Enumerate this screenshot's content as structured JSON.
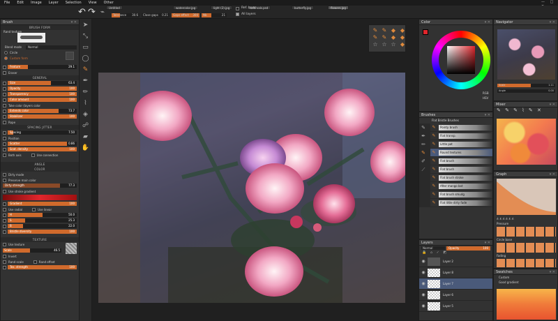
{
  "menu": [
    "File",
    "Edit",
    "Image",
    "Layer",
    "Selection",
    "View",
    "Other"
  ],
  "toolbar": {
    "tabs": [
      "Untitled",
      "watercolor.jpg",
      "light (2).jpg",
      "colorvals.psd",
      "butterfly.jpg",
      "flowers.jpg"
    ],
    "tolerance_label": "Tolerance",
    "tolerance_val": "30.6",
    "close_gaps_label": "Close gaps",
    "close_gaps_val": "0.21",
    "gaps_effect_label": "Gaps effect",
    "gaps_effect_val": "300",
    "nb_label": "Nb",
    "nb_val": "21",
    "ref_layer": "Ref. layer",
    "all_layers": "All layers"
  },
  "brush_panel": {
    "title": "Brush",
    "brush_form": "BRUSH FORM",
    "rand_texture": "Rand texture",
    "blend_mode_label": "Blend mode",
    "blend_mode_value": "Normal",
    "circle": "Circle",
    "custom_form": "Custom form",
    "feature_label": "Feature",
    "feature_val": "29.1",
    "feature_pct": 0.29,
    "eraser": "Eraser",
    "general": "GENERAL",
    "general_sliders": [
      {
        "label": "Size",
        "val": "63.4",
        "pct": 0.63
      },
      {
        "label": "Opacity",
        "val": "100",
        "pct": 1.0
      },
      {
        "label": "Transparency",
        "val": "100",
        "pct": 1.0
      },
      {
        "label": "Color amount",
        "val": "100",
        "pct": 1.0
      }
    ],
    "take_color": "Take color (layers color",
    "general_sliders2": [
      {
        "label": "Extends color",
        "val": "73.7",
        "pct": 0.74
      },
      {
        "label": "Stabilizer",
        "val": "100",
        "pct": 1.0
      }
    ],
    "rope": "Rope",
    "spacing_jitter": "SPACING JITTER",
    "spacing_label": "Spacing",
    "spacing_val": "7.50",
    "spacing_pct": 0.08,
    "position": "Position",
    "scatter_label": "Scatter",
    "scatter_val": "0.86",
    "scatter_pct": 0.86,
    "scat_density_label": "Scat. density",
    "scat_density_val": "100",
    "scat_density_pct": 1.0,
    "both_axis": "Both axis",
    "use_connection": "Use connection",
    "angle": "ANGLE",
    "color": "COLOR",
    "dirty_mode": "Dirty mode",
    "preserve_main": "Preserve main color",
    "dirty_strength_label": "Dirty strength",
    "dirty_strength_val": "77.3",
    "dirty_strength_pct": 0.77,
    "use_stroke_gradient": "Use stroke gradient",
    "gradient_label": "Gradient",
    "gradient_val": "100",
    "gradient_pct": 1.0,
    "use_radial": "Use radial",
    "use_linear": "Use linear",
    "hsb": [
      {
        "label": "H",
        "val": "50.0",
        "pct": 0.5
      },
      {
        "label": "S",
        "val": "25.3",
        "pct": 0.25
      },
      {
        "label": "B",
        "val": "22.0",
        "pct": 0.22
      }
    ],
    "bristle_label": "Bristle diversity",
    "bristle_val": "100",
    "bristle_pct": 1.0,
    "texture": "TEXTURE",
    "use_texture": "Use texture",
    "scale_label": "Scale",
    "scale_val": "46.5",
    "scale_pct": 0.46,
    "invert": "Invert",
    "rand_scale": "Rand scale",
    "rand_offset": "Rand offset",
    "tex_strength_label": "Tex. strength",
    "tex_strength_val": "100",
    "tex_strength_pct": 1.0
  },
  "color_panel": {
    "title": "Color",
    "rgb": "RGB",
    "hsv": "HSV",
    "accent": "#e0262c"
  },
  "brushes_panel": {
    "title": "Brushes",
    "group": "Flat Bristle Brushes",
    "items": [
      "Pointy brush",
      "Flat transp.",
      "Little pat",
      "Round textures",
      "Flat brush",
      "Flat brush",
      "Flat brush stroke",
      "After mango bot",
      "Flat brush smudg",
      "Flat little dirty fade"
    ]
  },
  "layers_panel": {
    "title": "Layers",
    "blend": "Normal",
    "opacity_label": "Opacity",
    "opacity_val": "100",
    "items": [
      "Layer 2",
      "Layer 8",
      "Layer 7",
      "Layer 6",
      "Layer 5"
    ]
  },
  "navigator_panel": {
    "title": "Navigator",
    "scale_label": "Scale",
    "scale_val": "1.11",
    "angle_label": "Angle",
    "angle_val": "0.00"
  },
  "mixer_panel": {
    "title": "Mixer"
  },
  "graph_panel": {
    "title": "Graph",
    "pressure": "Pressure",
    "circle_base": "Circle base",
    "fading": "Fading"
  },
  "swatches_panel": {
    "title": "Swatches",
    "custom": "Custom",
    "good_gradient": "Good gradient"
  }
}
